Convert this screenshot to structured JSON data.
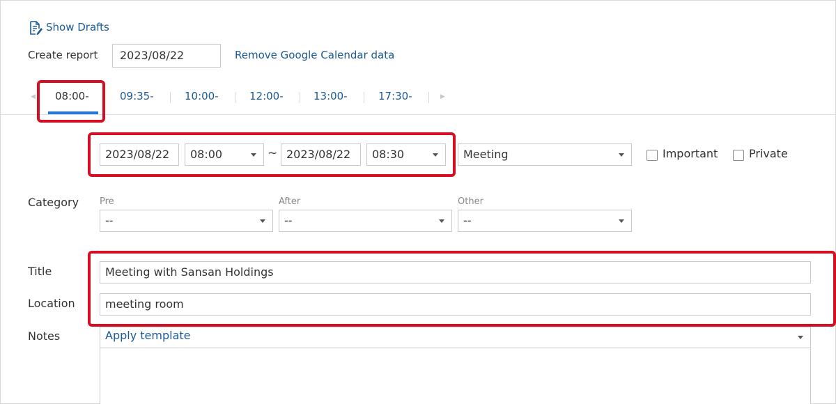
{
  "header": {
    "show_drafts": "Show Drafts",
    "create_report_label": "Create report",
    "report_date": "2023/08/22",
    "remove_gcal": "Remove Google Calendar data"
  },
  "tabs": [
    {
      "label": "08:00-",
      "active": true
    },
    {
      "label": "09:35-",
      "active": false
    },
    {
      "label": "10:00-",
      "active": false
    },
    {
      "label": "12:00-",
      "active": false
    },
    {
      "label": "13:00-",
      "active": false
    },
    {
      "label": "17:30-",
      "active": false
    }
  ],
  "schedule": {
    "start_date": "2023/08/22",
    "start_time": "08:00",
    "separator": "~",
    "end_date": "2023/08/22",
    "end_time": "08:30",
    "type": "Meeting",
    "important_label": "Important",
    "private_label": "Private",
    "important_checked": false,
    "private_checked": false
  },
  "category": {
    "label": "Category",
    "pre_label": "Pre",
    "pre_value": "--",
    "after_label": "After",
    "after_value": "--",
    "other_label": "Other",
    "other_value": "--"
  },
  "title": {
    "label": "Title",
    "value": "Meeting with Sansan Holdings"
  },
  "location": {
    "label": "Location",
    "value": "meeting room"
  },
  "notes": {
    "label": "Notes",
    "template_label": "Apply template",
    "value": ""
  },
  "colors": {
    "link": "#1a5a96",
    "highlight": "#d50f23",
    "tab_underline": "#2878d7"
  }
}
